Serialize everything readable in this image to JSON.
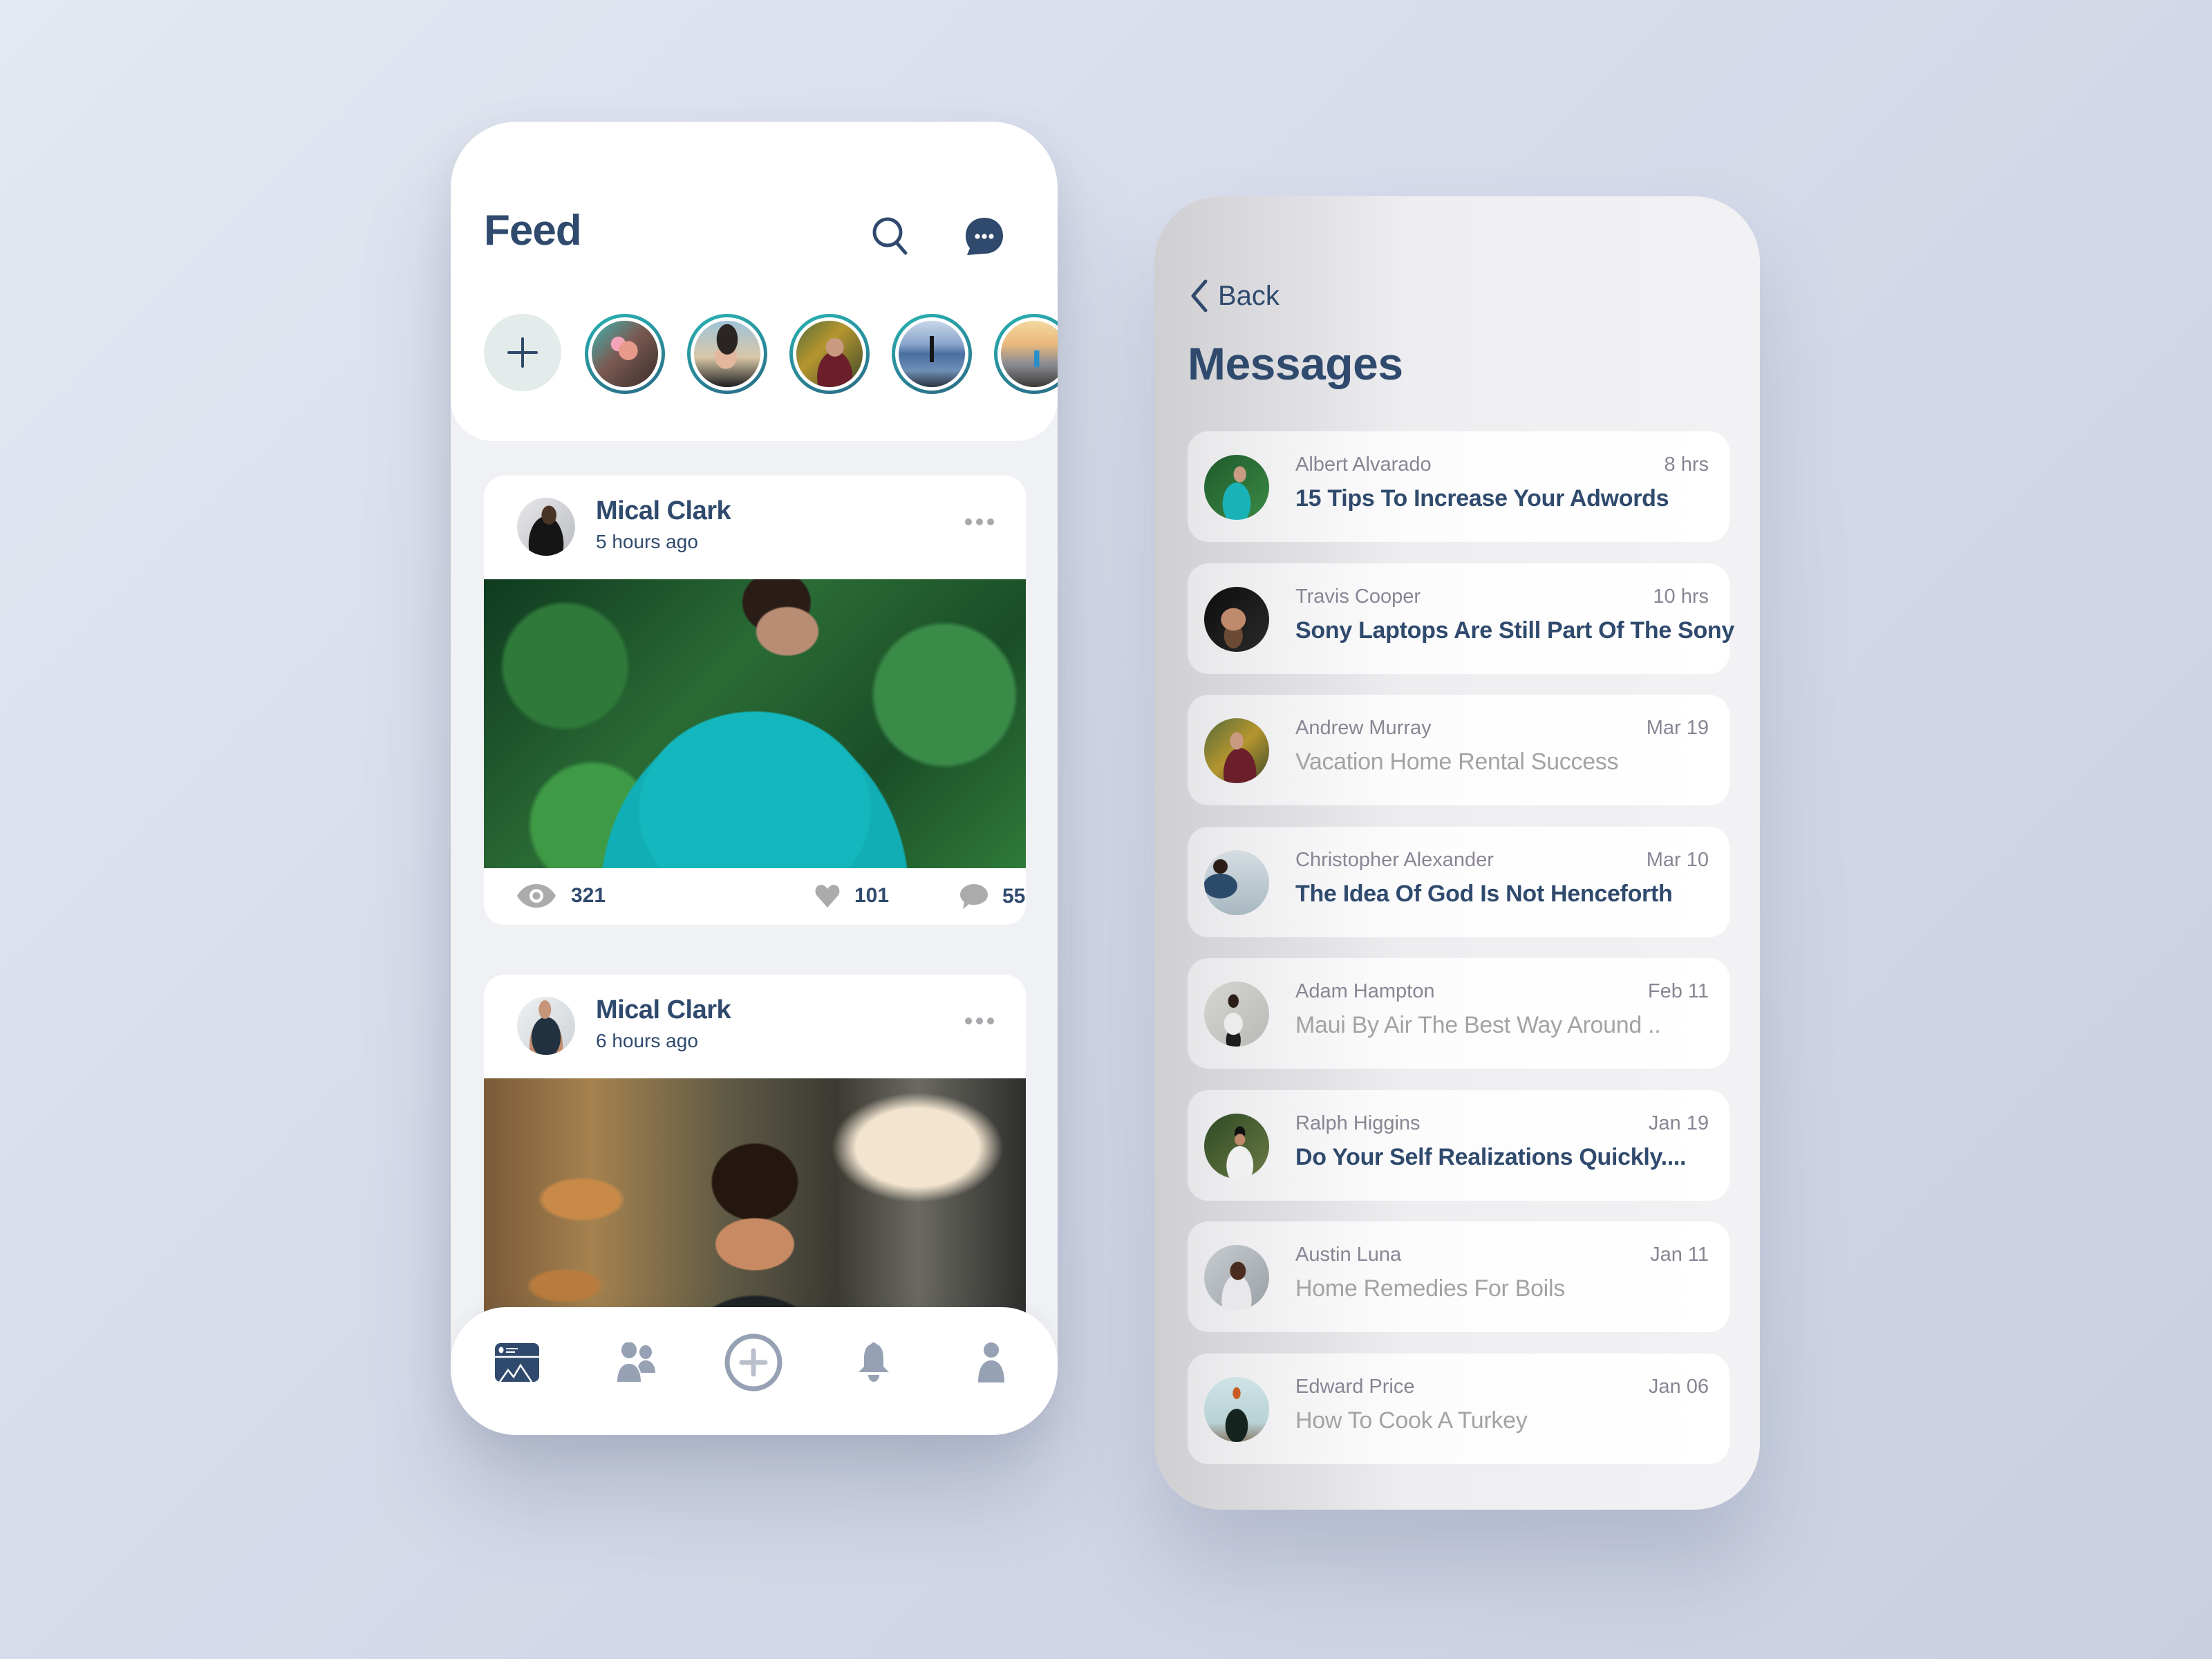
{
  "feed": {
    "title": "Feed",
    "icons": {
      "search": "search-icon",
      "messages": "chat-bubble-icon"
    },
    "stories": {
      "add_icon": "plus-icon",
      "items": [
        {
          "label": "story-1",
          "desc": "man with pink sunglasses"
        },
        {
          "label": "story-2",
          "desc": "man with styled hair"
        },
        {
          "label": "story-3",
          "desc": "bearded man in maroon shirt"
        },
        {
          "label": "story-4",
          "desc": "person standing by lake"
        },
        {
          "label": "story-5",
          "desc": "person on mountain at sunset"
        }
      ]
    },
    "posts": [
      {
        "author": "Mical Clark",
        "time": "5 hours ago",
        "image_desc": "man with glasses in teal shirt among ferns",
        "views": "321",
        "likes": "101",
        "comments": "55"
      },
      {
        "author": "Mical Clark",
        "time": "6 hours ago",
        "image_desc": "smiling young man in field at golden hour"
      }
    ],
    "bottom_nav": [
      {
        "name": "feed",
        "icon": "feed-icon",
        "active": true
      },
      {
        "name": "friends",
        "icon": "people-icon",
        "active": false
      },
      {
        "name": "create",
        "icon": "add-circle-icon",
        "active": false
      },
      {
        "name": "notifications",
        "icon": "bell-icon",
        "active": false
      },
      {
        "name": "profile",
        "icon": "user-icon",
        "active": false
      }
    ]
  },
  "messages": {
    "back_label": "Back",
    "title": "Messages",
    "items": [
      {
        "name": "Albert Alvarado",
        "date": "8 hrs",
        "subject": "15 Tips To Increase Your Adwords",
        "unread": true
      },
      {
        "name": "Travis Cooper",
        "date": "10 hrs",
        "subject": "Sony Laptops Are Still Part Of The Sony",
        "unread": true
      },
      {
        "name": "Andrew Murray",
        "date": "Mar 19",
        "subject": "Vacation Home Rental Success",
        "unread": false
      },
      {
        "name": "Christopher Alexander",
        "date": "Mar 10",
        "subject": "The Idea Of God Is Not Henceforth",
        "unread": true
      },
      {
        "name": "Adam Hampton",
        "date": "Feb 11",
        "subject": "Maui By Air The Best Way Around ..",
        "unread": false
      },
      {
        "name": "Ralph Higgins",
        "date": "Jan 19",
        "subject": "Do Your Self Realizations Quickly....",
        "unread": true
      },
      {
        "name": "Austin Luna",
        "date": "Jan 11",
        "subject": "Home Remedies For Boils",
        "unread": false
      },
      {
        "name": "Edward Price",
        "date": "Jan 06",
        "subject": "How To Cook A Turkey",
        "unread": false
      }
    ]
  },
  "colors": {
    "primary": "#2f4a6d",
    "muted": "#8a8494",
    "read_subject": "#a3a3a6",
    "story_ring": "#27b3b2",
    "nav_inactive": "#96a1b4"
  }
}
